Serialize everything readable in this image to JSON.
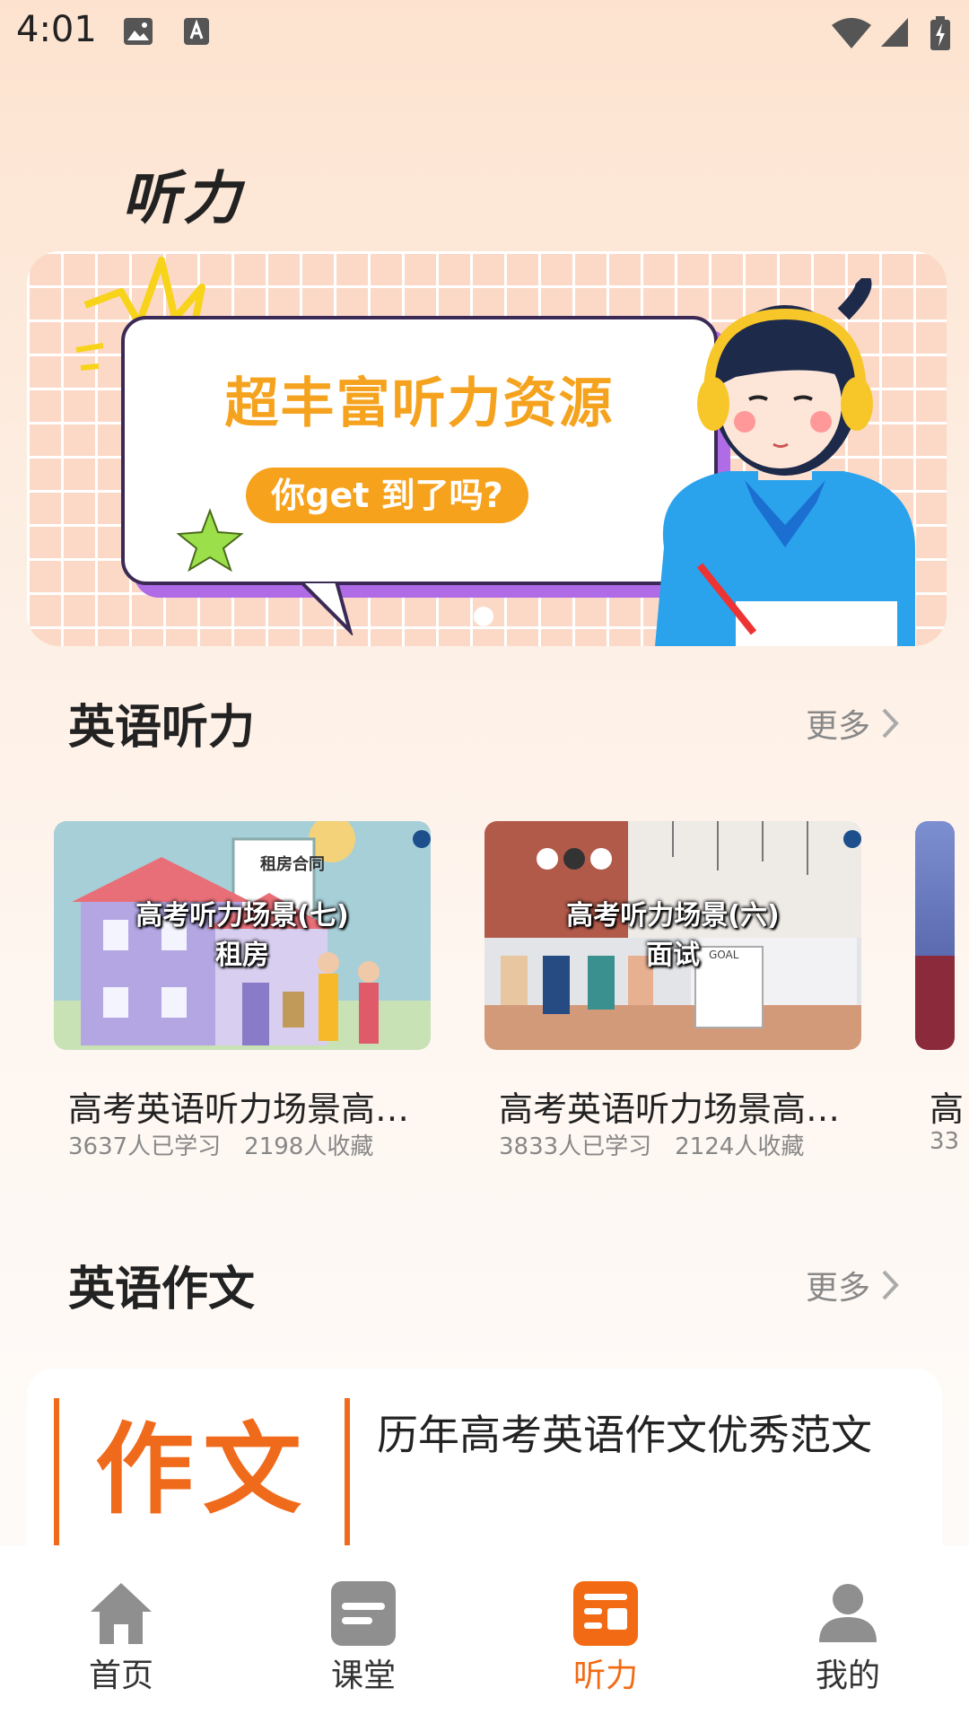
{
  "status_bar": {
    "time": "4:01"
  },
  "page": {
    "title": "听力"
  },
  "banner": {
    "headline": "超丰富听力资源",
    "pill": "你get 到了吗?"
  },
  "sections": {
    "listening": {
      "title": "英语听力",
      "more": "更多"
    },
    "essay": {
      "title": "英语作文",
      "more": "更多"
    }
  },
  "videos": [
    {
      "thumb_line1": "高考听力场景(七)",
      "thumb_line2": "租房",
      "sign": "租房合同",
      "title": "高考英语听力场景高考英语听力场景",
      "learned": "3637人已学习",
      "favorites": "2198人收藏"
    },
    {
      "thumb_line1": "高考听力场景(六)",
      "thumb_line2": "面试",
      "sign": "GOAL",
      "title": "高考英语听力场景高考英语听力场景",
      "learned": "3833人已学习",
      "favorites": "2124人收藏"
    },
    {
      "title": "高",
      "learned": "33"
    }
  ],
  "essay": {
    "thumb_text": "作文",
    "title": "历年高考英语作文优秀范文"
  },
  "nav": [
    {
      "label": "首页",
      "icon": "home-icon",
      "active": false
    },
    {
      "label": "课堂",
      "icon": "classroom-icon",
      "active": false
    },
    {
      "label": "听力",
      "icon": "listening-icon",
      "active": true
    },
    {
      "label": "我的",
      "icon": "profile-icon",
      "active": false
    }
  ],
  "colors": {
    "accent": "#f26a14",
    "banner_yellow": "#f5a31f",
    "inactive_icon": "#8f8f8f"
  }
}
